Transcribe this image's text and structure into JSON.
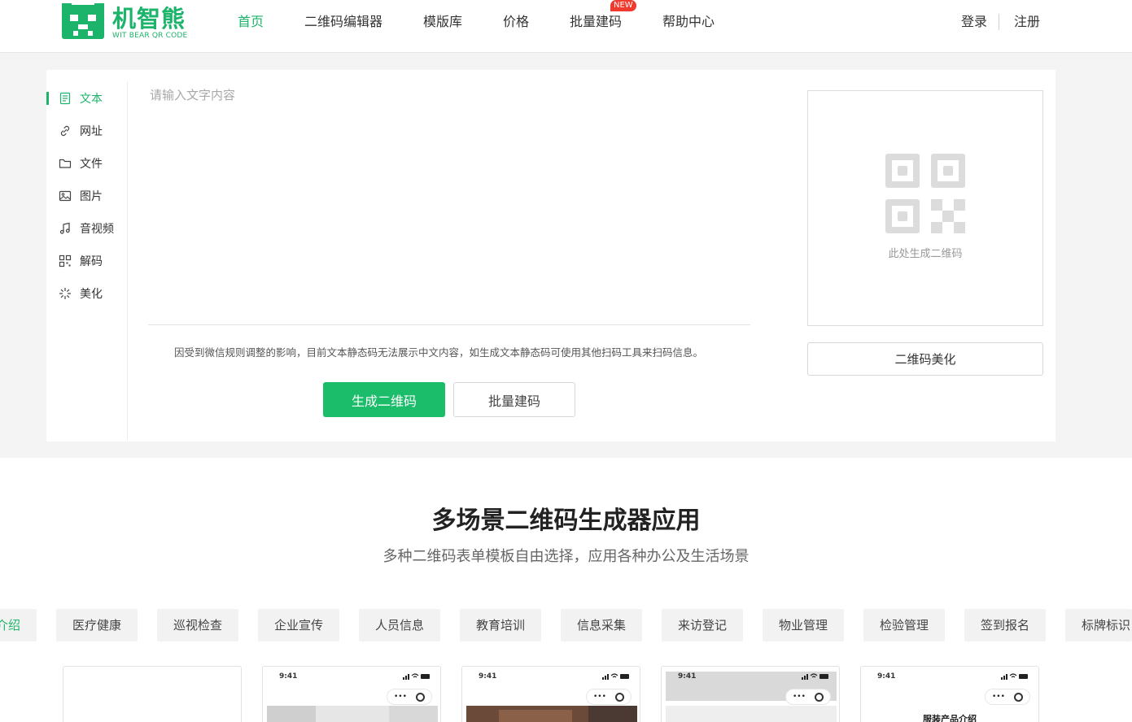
{
  "brand": {
    "name": "机智熊",
    "tagline": "WIT BEAR QR CODE",
    "accent": "#1bb46a"
  },
  "nav": {
    "items": [
      {
        "label": "首页",
        "active": true
      },
      {
        "label": "二维码编辑器"
      },
      {
        "label": "模版库"
      },
      {
        "label": "价格"
      },
      {
        "label": "批量建码"
      },
      {
        "label": "帮助中心"
      }
    ],
    "new_badge": "NEW",
    "login": "登录",
    "register": "注册"
  },
  "generator": {
    "types": [
      {
        "label": "文本",
        "icon": "document-icon",
        "active": true
      },
      {
        "label": "网址",
        "icon": "link-icon"
      },
      {
        "label": "文件",
        "icon": "folder-icon"
      },
      {
        "label": "图片",
        "icon": "image-icon"
      },
      {
        "label": "音视频",
        "icon": "music-note-icon"
      },
      {
        "label": "解码",
        "icon": "qr-scan-icon"
      },
      {
        "label": "美化",
        "icon": "sparkle-icon"
      }
    ],
    "input_placeholder": "请输入文字内容",
    "input_value": "",
    "notice": "因受到微信规则调整的影响，目前文本静态码无法展示中文内容，如生成文本静态码可使用其他扫码工具来扫码信息。",
    "generate_label": "生成二维码",
    "batch_label": "批量建码",
    "preview_text": "此处生成二维码",
    "beautify_label": "二维码美化"
  },
  "scenes": {
    "title": "多场景二维码生成器应用",
    "subtitle": "多种二维码表单模板自由选择，应用各种办公及生活场景",
    "tabs": [
      {
        "label": "介绍",
        "active": true
      },
      {
        "label": "医疗健康"
      },
      {
        "label": "巡视检查"
      },
      {
        "label": "企业宣传"
      },
      {
        "label": "人员信息"
      },
      {
        "label": "教育培训"
      },
      {
        "label": "信息采集"
      },
      {
        "label": "来访登记"
      },
      {
        "label": "物业管理"
      },
      {
        "label": "检验管理"
      },
      {
        "label": "签到报名"
      },
      {
        "label": "标牌标识"
      }
    ],
    "cards": [
      {
        "time": "",
        "heading": ""
      },
      {
        "time": "9:41",
        "heading": ""
      },
      {
        "time": "9:41",
        "heading": ""
      },
      {
        "time": "9:41",
        "heading": ""
      },
      {
        "time": "9:41",
        "heading": "服装产品介绍"
      }
    ]
  }
}
